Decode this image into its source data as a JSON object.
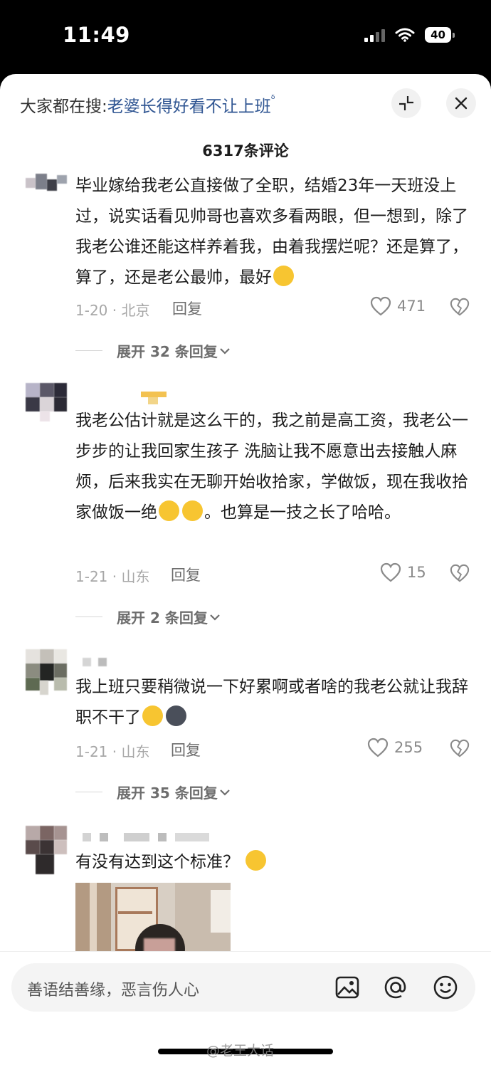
{
  "status": {
    "time": "11:49",
    "battery": "40"
  },
  "header": {
    "search_prefix": "大家都在搜:",
    "search_term": "老婆长得好看不让上班",
    "search_icon_char": "ᵟ",
    "comment_count": "6317条评论"
  },
  "comments": [
    {
      "text_parts": [
        "毕业嫁给我老公直接做了全职，结婚23年一天班没上过，说实话看见帅哥也喜欢多看两眼，但一想到，除了我老公谁还能这样养着我，由着我摆烂呢？还是算了，算了，还是老公最帅，最好"
      ],
      "meta": "1-20 · 北京",
      "reply": "回复",
      "likes": "471",
      "expand": "展开 32 条回复"
    },
    {
      "text_a": "我老公估计就是这么干的，我之前是高工资，我老公一步步的让我回家生孩子 洗脑让我不愿意出去接触人麻烦，后来我实在无聊开始收拾家，学做饭，现在我收拾家做饭一绝",
      "text_b": "。也算是一技之长了哈哈。",
      "meta": "1-21 · 山东",
      "reply": "回复",
      "likes": "15",
      "expand": "展开 2 条回复"
    },
    {
      "text": "我上班只要稍微说一下好累啊或者啥的我老公就让我辞职不干了",
      "meta": "1-21 · 山东",
      "reply": "回复",
      "likes": "255",
      "expand": "展开 35 条回复"
    },
    {
      "text": "有没有达到这个标准？"
    }
  ],
  "input": {
    "placeholder": "善语结善缘，恶言伤人心"
  },
  "watermark": "@老王大话",
  "colors": {
    "link": "#2f5592",
    "meta": "#a7a7a7",
    "emoji": "#f7c531"
  }
}
